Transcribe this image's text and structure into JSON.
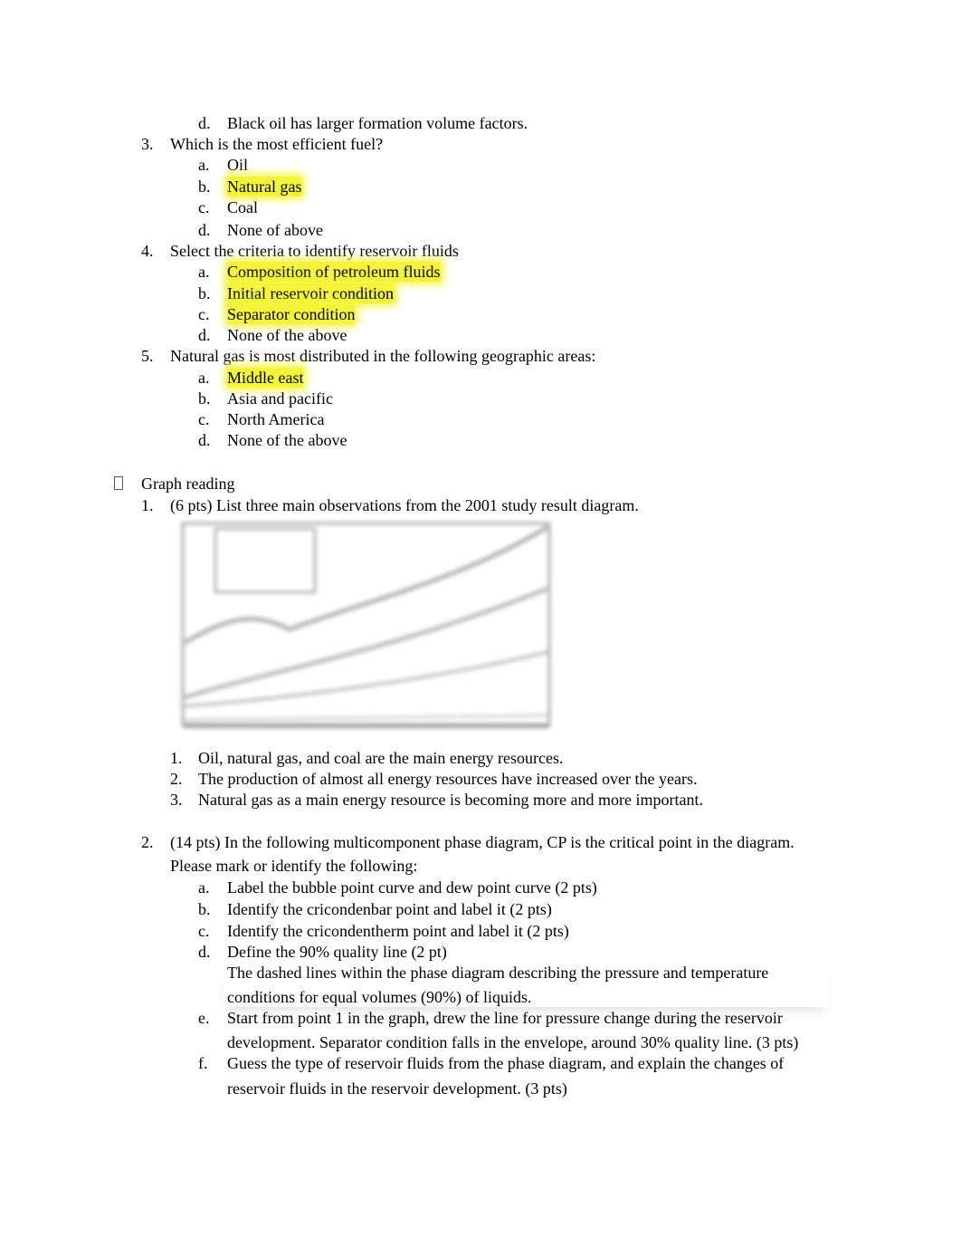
{
  "q2_tail": {
    "label": "d.",
    "text": "Black oil has larger formation volume factors."
  },
  "q3": {
    "num": "3.",
    "text": "Which is the most efficient fuel?",
    "options": [
      {
        "label": "a.",
        "text": "Oil"
      },
      {
        "label": "b.",
        "text": "Natural gas",
        "highlighted": true
      },
      {
        "label": "c.",
        "text": "Coal"
      },
      {
        "label": "d.",
        "text": "None of above"
      }
    ]
  },
  "q4": {
    "num": "4.",
    "text": "Select the criteria to identify reservoir fluids",
    "options": [
      {
        "label": "a.",
        "text": "Composition of petroleum fluids",
        "highlighted": true
      },
      {
        "label": "b.",
        "text": "Initial reservoir condition",
        "highlighted": true
      },
      {
        "label": "c.",
        "text": "Separator condition",
        "highlighted": true
      },
      {
        "label": "d.",
        "text": "None of the above"
      }
    ]
  },
  "q5": {
    "num": "5.",
    "text": "Natural gas is most distributed in the following geographic areas:",
    "options": [
      {
        "label": "a.",
        "text": "Middle east",
        "highlighted": true
      },
      {
        "label": "b.",
        "text": "Asia and pacific"
      },
      {
        "label": "c.",
        "text": "North America"
      },
      {
        "label": "d.",
        "text": "None of the above"
      }
    ]
  },
  "section": {
    "bullet": "",
    "title": "Graph reading"
  },
  "g1": {
    "num": "1.",
    "text": "(6 pts) List three main observations from the 2001 study result diagram.",
    "answers": [
      {
        "num": "1.",
        "text": "Oil, natural gas, and coal are the main energy resources."
      },
      {
        "num": "2.",
        "text": "The production of almost all energy resources have increased over the years."
      },
      {
        "num": "3.",
        "text": "Natural gas as a main energy resource is becoming more and more important."
      }
    ]
  },
  "g2": {
    "num": "2.",
    "text1": "(14 pts) In the following multicomponent phase diagram, CP is the critical point in the diagram.",
    "text2": "Please mark or identify the following:",
    "items": [
      {
        "label": "a.",
        "text": "Label the bubble point curve and dew point curve (2 pts)"
      },
      {
        "label": "b.",
        "text": "Identify the cricondenbar point and label it (2 pts)"
      },
      {
        "label": "c.",
        "text": "Identify the cricondentherm point and label it (2 pts)"
      },
      {
        "label": "d.",
        "text": "Define the 90% quality line (2 pt)"
      }
    ],
    "d_answer1": "The dashed lines within the phase diagram describing the pressure and temperature",
    "d_answer2": "conditions for equal volumes (90%) of liquids.",
    "e": {
      "label": "e.",
      "text1": "Start from point 1 in the graph, drew the line for pressure change during the reservoir",
      "text2": "development. Separator condition falls in the envelope, around 30% quality line. (3 pts)"
    },
    "f": {
      "label": "f.",
      "text1": "Guess the type of reservoir fluids from the phase diagram, and explain the changes of",
      "text2": "reservoir fluids in the reservoir development. (3 pts)"
    }
  }
}
